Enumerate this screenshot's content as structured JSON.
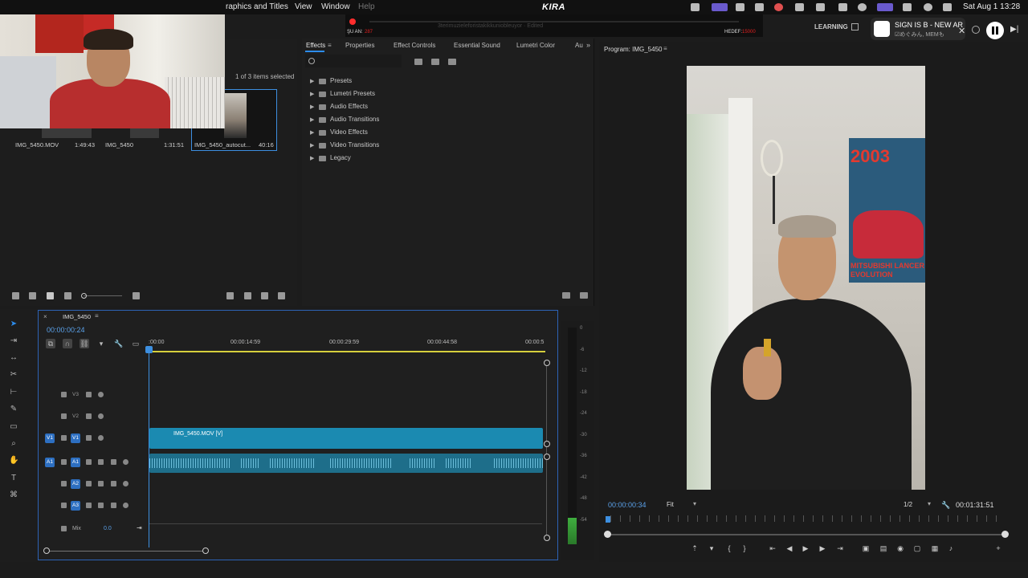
{
  "menubar": {
    "items": [
      "raphics and Titles",
      "View",
      "Window",
      "Help"
    ],
    "center_logo": "KIRA",
    "clock": "Sat Aug 1  13:28"
  },
  "overlay": {
    "live_label": "ŞU AN:",
    "live_value": "287",
    "ghost_text": "3terimuzieleforistakikkuniobleuyor · Edited",
    "goal_label": "HEDEF:",
    "goal_value": "15000"
  },
  "workspace": {
    "learning": "LEARNING"
  },
  "notification": {
    "title": "SIGN IS B - NEW AR",
    "subtitle": "☑めぐみん, MEMも"
  },
  "project": {
    "selection_info": "1 of 3 items selected",
    "items": [
      {
        "name": "IMG_5450.MOV",
        "duration": "1:49:43"
      },
      {
        "name": "IMG_5450",
        "duration": "1:31:51"
      },
      {
        "name": "IMG_5450_autocut...",
        "duration": "40:16"
      }
    ]
  },
  "effects": {
    "tabs": [
      "Effects",
      "Properties",
      "Effect Controls",
      "Essential Sound",
      "Lumetri Color",
      "Au"
    ],
    "folders": [
      "Presets",
      "Lumetri Presets",
      "Audio Effects",
      "Audio Transitions",
      "Video Effects",
      "Video Transitions",
      "Legacy"
    ]
  },
  "program": {
    "title": "Program: IMG_5450",
    "current_time": "00:00:00:34",
    "fit": "Fit",
    "resolution": "1/2",
    "duration": "00:01:31:51",
    "poster_year": "2003",
    "poster_text": "MITSUBISHI LANCER EVOLUTION"
  },
  "timeline": {
    "sequence_name": "IMG_5450",
    "current_time": "00:00:00:24",
    "ruler": [
      ":00:00",
      "00:00:14:59",
      "00:00:29:59",
      "00:00:44:58",
      "00:00:5"
    ],
    "video_tracks": [
      "V3",
      "V2",
      "V1"
    ],
    "audio_tracks": [
      "A1",
      "A2",
      "A3"
    ],
    "v1_source": "V1",
    "a1_source": "A1",
    "video_clip": "IMG_5450.MOV [V]",
    "mix_label": "Mix",
    "mix_value": "0.0"
  },
  "meter": {
    "labels": [
      "0",
      "-6",
      "-12",
      "-18",
      "-24",
      "-30",
      "-36",
      "-42",
      "-48",
      "-54"
    ]
  }
}
